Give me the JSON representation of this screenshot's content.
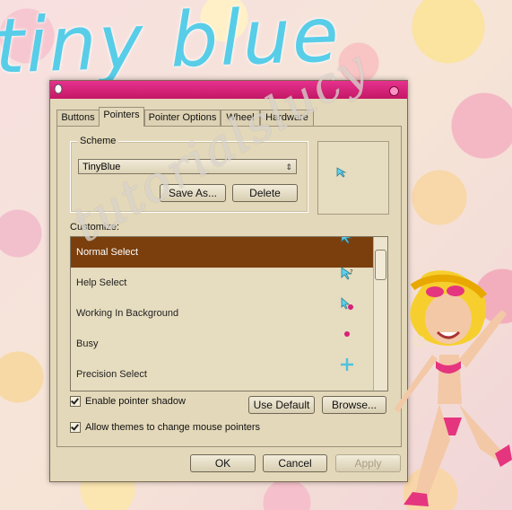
{
  "title_art": "tiny blue",
  "watermark": "tutorialslucy",
  "dialog": {
    "tabs": [
      "Buttons",
      "Pointers",
      "Pointer Options",
      "Wheel",
      "Hardware"
    ],
    "active_tab": "Pointers",
    "scheme": {
      "label": "Scheme",
      "selected": "TinyBlue",
      "save_as": "Save As...",
      "delete": "Delete"
    },
    "customize": {
      "label": "Customize:",
      "rows": [
        {
          "name": "Normal Select",
          "icon": "arrow-cursor-icon",
          "selected": true
        },
        {
          "name": "Help Select",
          "icon": "help-cursor-icon"
        },
        {
          "name": "Working In Background",
          "icon": "working-cursor-icon"
        },
        {
          "name": "Busy",
          "icon": "busy-cursor-icon"
        },
        {
          "name": "Precision Select",
          "icon": "crosshair-cursor-icon"
        }
      ]
    },
    "shadow_label": "Enable pointer shadow",
    "themes_label": "Allow themes to change mouse pointers",
    "use_default": "Use Default",
    "browse": "Browse...",
    "ok": "OK",
    "cancel": "Cancel",
    "apply": "Apply"
  },
  "colors": {
    "titlebar": "#d81f78",
    "selection": "#7a3f0d",
    "cursor": "#5fd0ea",
    "dot": "#d81f78"
  }
}
